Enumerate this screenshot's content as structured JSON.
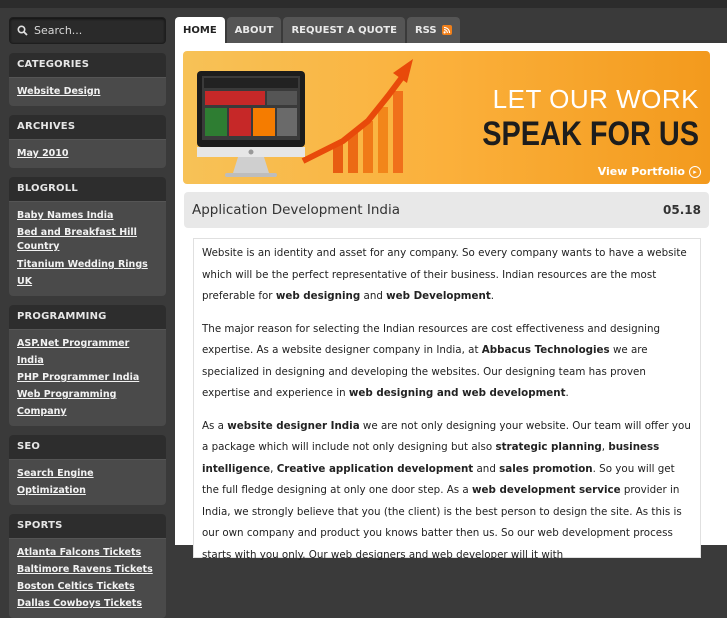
{
  "search": {
    "placeholder": "Search..."
  },
  "sidebar": [
    {
      "title": "CATEGORIES",
      "items": [
        "Website Design"
      ]
    },
    {
      "title": "ARCHIVES",
      "items": [
        "May 2010"
      ]
    },
    {
      "title": "BLOGROLL",
      "items": [
        "Baby Names India",
        "Bed and Breakfast Hill Country",
        "Titanium Wedding Rings UK"
      ]
    },
    {
      "title": "PROGRAMMING",
      "items": [
        "ASP.Net Programmer India",
        "PHP Programmer India",
        "Web Programming Company"
      ]
    },
    {
      "title": "SEO",
      "items": [
        "Search Engine Optimization"
      ]
    },
    {
      "title": "SPORTS",
      "items": [
        "Atlanta Falcons Tickets",
        "Baltimore Ravens Tickets",
        "Boston Celtics Tickets",
        "Dallas Cowboys Tickets"
      ]
    }
  ],
  "tabs": [
    "HOME",
    "ABOUT",
    "REQUEST A QUOTE",
    "RSS"
  ],
  "banner": {
    "line1": "LET OUR WORK",
    "line2": "SPEAK FOR US",
    "link": "View Portfolio"
  },
  "post": {
    "title": "Application Development India",
    "date": "05.18",
    "p1": [
      "Website is an identity and asset for any company. So every company wants to have a website which will be the perfect representative of their business. Indian resources are the most preferable for ",
      "web designing",
      " and ",
      "web Development",
      "."
    ],
    "p2": [
      "The major reason for selecting the Indian resources are cost effectiveness and designing expertise. As a website designer company in India, at ",
      "Abbacus Technologies",
      " we are specialized in designing and developing the websites.  Our designing team has proven expertise and experience in ",
      "web designing and web development",
      "."
    ],
    "p3": [
      "As a ",
      "website designer India",
      " we are not only designing your website. Our team will offer you a package which will include not only designing but also ",
      "strategic planning",
      ", ",
      "business intelligence",
      ", ",
      "Creative application development",
      " and ",
      "sales promotion",
      ". So you will get the full fledge designing at only one door step. As a ",
      "web development service",
      " provider in India, we strongly believe that you (the client) is the best person to design the site. As this is our own company and product you knows batter then us. So our web development process starts with you only. Our web designers and web developer will it with"
    ]
  }
}
